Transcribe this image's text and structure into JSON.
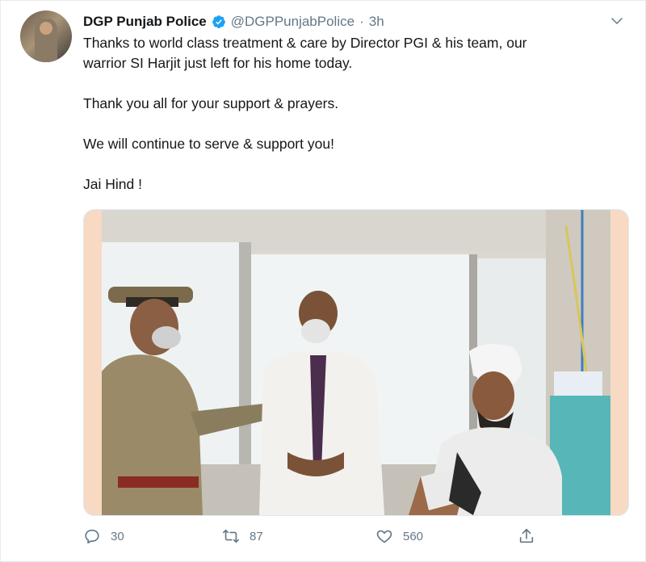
{
  "tweet": {
    "display_name": "DGP Punjab Police",
    "handle": "@DGPPunjabPolice",
    "separator": "·",
    "time": "3h",
    "lines": [
      "Thanks to world class treatment & care by Director PGI & his team, our",
      "warrior SI Harjit just left for his home today.",
      "Thank you all for your support & prayers.",
      "We will continue to serve & support you!",
      "Jai Hind !"
    ]
  },
  "media": {
    "icon": "photo",
    "description_hidden": true
  },
  "actions": {
    "reply_count": "30",
    "retweet_count": "87",
    "like_count": "560"
  },
  "icons": [
    "verified-badge-icon",
    "caret-down-icon",
    "reply-icon",
    "retweet-icon",
    "like-icon",
    "share-icon"
  ],
  "colors": {
    "text": "#14171a",
    "secondary": "#657786",
    "verified": "#1da1f2",
    "border": "#e6ecf0"
  }
}
